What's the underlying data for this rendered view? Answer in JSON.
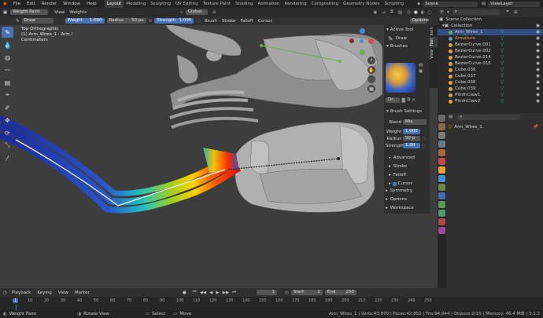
{
  "menu": {
    "items": [
      "File",
      "Edit",
      "Render",
      "Window",
      "Help"
    ],
    "tabs": [
      "Layout",
      "Modeling",
      "Sculpting",
      "UV Editing",
      "Texture Paint",
      "Shading",
      "Animation",
      "Rendering",
      "Compositing",
      "Geometry Nodes",
      "Scripting"
    ],
    "active_tab": "Layout",
    "scene": "Scene",
    "view_layer": "ViewLayer"
  },
  "viewport_header": {
    "mode": "Weight Paint",
    "view": "View",
    "weights": "Weights",
    "orientation": "Global"
  },
  "tool_header": {
    "brush": "Draw",
    "weight_label": "Weight",
    "weight_value": "1.000",
    "radius_label": "Radius",
    "radius_value": "50 px",
    "strength_label": "Strength",
    "strength_value": "1.000",
    "menus": [
      "Brush",
      "Stroke",
      "Falloff",
      "Cursor"
    ],
    "options": "Options"
  },
  "overlay": {
    "line1": "Top Orthographic",
    "line2": "(1) Arm_Wires_1 : Arm.l",
    "line3": "Centimeters"
  },
  "npanel": {
    "tabs": [
      "Item",
      "Tool",
      "View"
    ],
    "active_tool_header": "Active Tool",
    "active_tool_name": "Draw",
    "brushes_header": "Brushes",
    "brush_name": "Dr...",
    "brush_settings_header": "Brush Settings",
    "blend_label": "Blend",
    "blend_value": "Mix",
    "weight_label": "Weight",
    "weight_value": "1.000",
    "radius_label": "Radius",
    "radius_value": "50 p",
    "strength_label": "Strength",
    "strength_value": "1.00",
    "subsections": [
      "Advanced",
      "Stroke",
      "Falloff",
      "Cursor"
    ],
    "sections": [
      "Symmetry",
      "Options",
      "Workspace"
    ]
  },
  "outliner": {
    "root": "Scene Collection",
    "collection": "Collection",
    "items": [
      {
        "name": "Arm_Wires_1",
        "selected": true
      },
      {
        "name": "Armature",
        "selected": false
      },
      {
        "name": "BezierCurve.001",
        "selected": false
      },
      {
        "name": "BezierCurve.002",
        "selected": false
      },
      {
        "name": "BezierCurve.014",
        "selected": false
      },
      {
        "name": "BezierCurve.015",
        "selected": false
      },
      {
        "name": "Cube.036",
        "selected": false
      },
      {
        "name": "Cube.037",
        "selected": false
      },
      {
        "name": "Cube.038",
        "selected": false
      },
      {
        "name": "Cube.039",
        "selected": false
      },
      {
        "name": "PlinthClaw1",
        "selected": false
      },
      {
        "name": "PlinthClaw2",
        "selected": false
      }
    ]
  },
  "properties": {
    "object_name": "Arm_Wires_1"
  },
  "timeline": {
    "menus": [
      "Playback",
      "Keying",
      "View",
      "Marker"
    ],
    "current_frame": "1",
    "start_label": "Start",
    "start_value": "1",
    "end_label": "End",
    "end_value": "250",
    "frames": [
      "1",
      "10",
      "20",
      "30",
      "40",
      "50",
      "60",
      "70",
      "80",
      "90",
      "100",
      "110",
      "120",
      "130",
      "140",
      "150",
      "160",
      "170",
      "180",
      "190",
      "200",
      "210",
      "220",
      "230",
      "240",
      "250"
    ]
  },
  "status": {
    "left_action": "Weight Paint",
    "middle_action": "Rotate View",
    "select_label": "Select",
    "move_label": "Move",
    "stats": "Arm_Wires_1 | Verts:43,870 | Faces:42,852 | Tris:84,044 | Objects:2/15 | Memory: 46.4 MiB | 3.1.2"
  },
  "colors": {
    "accent": "#4772b3",
    "viewport_bg": "#3d3d3d",
    "selection": "#334d80"
  }
}
